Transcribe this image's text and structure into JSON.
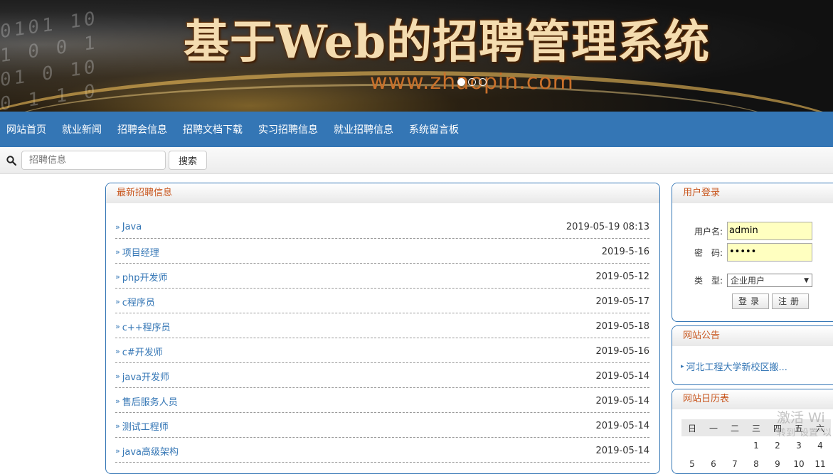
{
  "banner": {
    "title": "基于Web的招聘管理系统",
    "url": "www.zhaopin.com",
    "slides": 3,
    "active_slide": 1
  },
  "nav": {
    "items": [
      "网站首页",
      "就业新闻",
      "招聘会信息",
      "招聘文档下载",
      "实习招聘信息",
      "就业招聘信息",
      "系统留言板"
    ]
  },
  "search": {
    "placeholder": "招聘信息",
    "button": "搜索"
  },
  "news": {
    "title": "最新招聘信息",
    "items": [
      {
        "title": "Java",
        "date": "2019-05-19 08:13"
      },
      {
        "title": "项目经理",
        "date": "2019-5-16"
      },
      {
        "title": "php开发师",
        "date": "2019-05-12"
      },
      {
        "title": "c程序员",
        "date": "2019-05-17"
      },
      {
        "title": "c++程序员",
        "date": "2019-05-18"
      },
      {
        "title": "c#开发师",
        "date": "2019-05-16"
      },
      {
        "title": "java开发师",
        "date": "2019-05-14"
      },
      {
        "title": "售后服务人员",
        "date": "2019-05-14"
      },
      {
        "title": "测试工程师",
        "date": "2019-05-14"
      },
      {
        "title": "java高级架构",
        "date": "2019-05-14"
      }
    ]
  },
  "login": {
    "title": "用户登录",
    "username_label": "用户名:",
    "username_value": "admin",
    "password_label": "密　码:",
    "password_value": "•••••",
    "type_label": "类　型:",
    "type_value": "企业用户",
    "login_button": "登录",
    "register_button": "注册"
  },
  "notice": {
    "title": "网站公告",
    "item": "河北工程大学新校区搬..."
  },
  "calendar": {
    "title": "网站日历表",
    "weekdays": [
      "日",
      "一",
      "二",
      "三",
      "四",
      "五",
      "六"
    ],
    "row1": [
      "",
      "",
      "",
      "1",
      "2",
      "3",
      "4"
    ],
    "row2": [
      "5",
      "6",
      "7",
      "8",
      "9",
      "10",
      "11"
    ]
  },
  "watermark": {
    "line1": "激活 Wi",
    "line2": "转到\"设置\"以"
  },
  "colors": {
    "nav": "#3476b5",
    "panel_title": "#c8561e",
    "link": "#3476b5"
  }
}
